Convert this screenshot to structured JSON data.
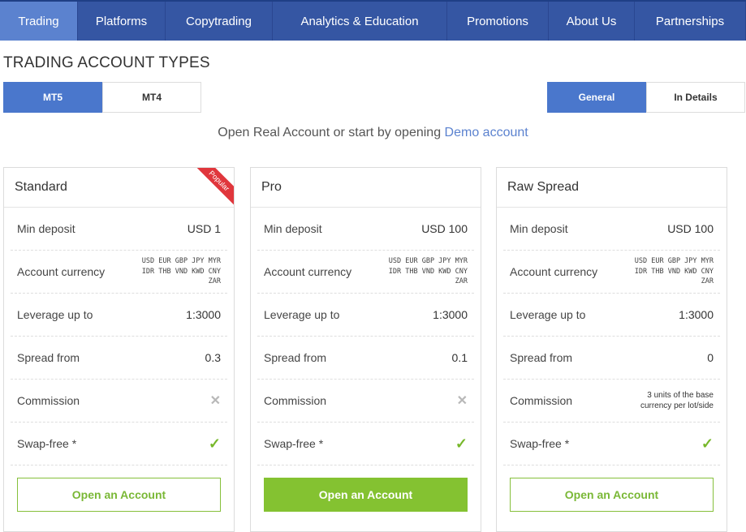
{
  "nav": {
    "items": [
      {
        "label": "Trading"
      },
      {
        "label": "Platforms"
      },
      {
        "label": "Copytrading"
      },
      {
        "label": "Analytics & Education"
      },
      {
        "label": "Promotions"
      },
      {
        "label": "About Us"
      },
      {
        "label": "Partnerships"
      }
    ],
    "active_color": "#5b82cf",
    "bar_color": "#3556a3"
  },
  "page_title": "TRADING ACCOUNT TYPES",
  "platform_toggle": {
    "mt5": "MT5",
    "mt4": "MT4",
    "selected": "MT5"
  },
  "view_toggle": {
    "general": "General",
    "details": "In Details",
    "selected": "General"
  },
  "subtitle": {
    "text": "Open Real Account or start by opening ",
    "link": "Demo account"
  },
  "labels": {
    "min_deposit": "Min deposit",
    "account_currency": "Account currency",
    "leverage": "Leverage up to",
    "spread": "Spread from",
    "commission": "Commission",
    "swap_free": "Swap-free *"
  },
  "cards": [
    {
      "title": "Standard",
      "badge": "Popular",
      "min_deposit": "USD 1",
      "currencies": [
        "USD EUR GBP JPY MYR",
        "IDR THB VND KWD CNY",
        "ZAR"
      ],
      "leverage": "1:3000",
      "spread": "0.3",
      "commission": "x-icon",
      "swap_free": "check-icon",
      "cta": "Open an Account"
    },
    {
      "title": "Pro",
      "min_deposit": "USD 100",
      "currencies": [
        "USD EUR GBP JPY MYR",
        "IDR THB VND KWD CNY",
        "ZAR"
      ],
      "leverage": "1:3000",
      "spread": "0.1",
      "commission": "x-icon",
      "swap_free": "check-icon",
      "cta": "Open an Account"
    },
    {
      "title": "Raw Spread",
      "min_deposit": "USD 100",
      "currencies": [
        "USD EUR GBP JPY MYR",
        "IDR THB VND KWD CNY",
        "ZAR"
      ],
      "leverage": "1:3000",
      "spread": "0",
      "commission_text": [
        "3 units of the base",
        "currency per lot/side"
      ],
      "swap_free": "check-icon",
      "cta": "Open an Account"
    }
  ]
}
